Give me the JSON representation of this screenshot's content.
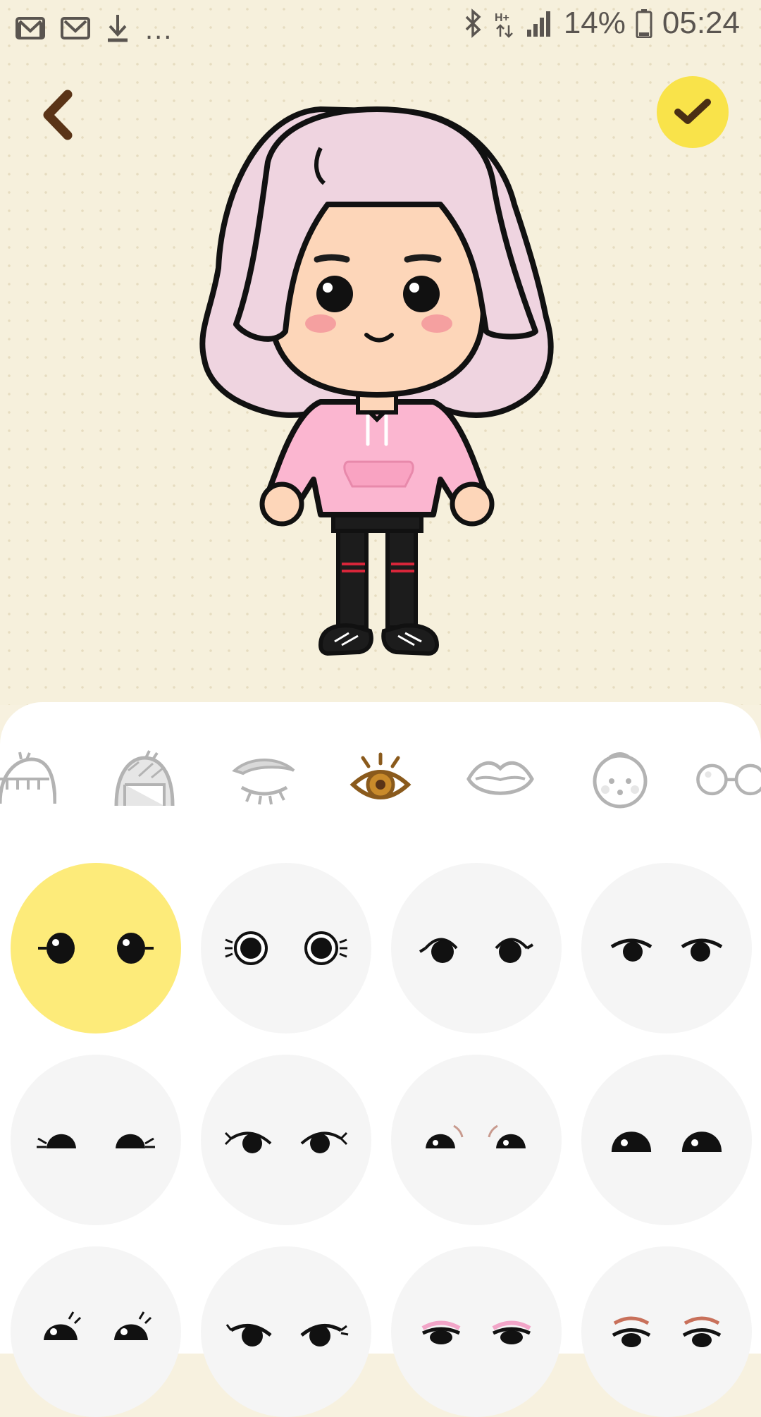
{
  "status_bar": {
    "notification_icons": [
      "gmail-icon",
      "gmail-icon",
      "download-icon"
    ],
    "more_label": "...",
    "right_icons": [
      "bluetooth-icon",
      "network-hplus-icon",
      "signal-icon"
    ],
    "battery_percent": "14%",
    "time": "05:24"
  },
  "header": {
    "back_icon": "chevron-left-icon",
    "confirm_icon": "checkmark-icon",
    "confirm_color": "#f9e34a"
  },
  "avatar": {
    "hair_color": "#efd4e0",
    "skin_color": "#fdd6b9",
    "hoodie_color": "#fbb6d0",
    "blush_color": "#f5a0a0"
  },
  "categories": [
    {
      "name": "hair-front",
      "selected": false
    },
    {
      "name": "hair-back",
      "selected": false
    },
    {
      "name": "eyebrows",
      "selected": false
    },
    {
      "name": "eyes",
      "selected": true
    },
    {
      "name": "mouth",
      "selected": false
    },
    {
      "name": "face",
      "selected": false
    },
    {
      "name": "glasses",
      "selected": false
    }
  ],
  "eye_options": [
    {
      "style": "round-lashes",
      "selected": true
    },
    {
      "style": "ringed",
      "selected": false
    },
    {
      "style": "arched",
      "selected": false
    },
    {
      "style": "lidded",
      "selected": false
    },
    {
      "style": "half-closed-lashes",
      "selected": false
    },
    {
      "style": "winged",
      "selected": false
    },
    {
      "style": "brow-pink",
      "selected": false
    },
    {
      "style": "bold-lid",
      "selected": false
    },
    {
      "style": "lashes-curl",
      "selected": false
    },
    {
      "style": "side-wing",
      "selected": false
    },
    {
      "style": "pink-shadow",
      "selected": false
    },
    {
      "style": "brown-brow",
      "selected": false
    }
  ],
  "colors": {
    "background": "#f6f0dc",
    "panel": "#ffffff",
    "option_bg": "#f5f5f5",
    "option_selected": "#fdeb7a",
    "category_selected": "#8a5a1c",
    "category_idle": "#b3b3b3"
  }
}
